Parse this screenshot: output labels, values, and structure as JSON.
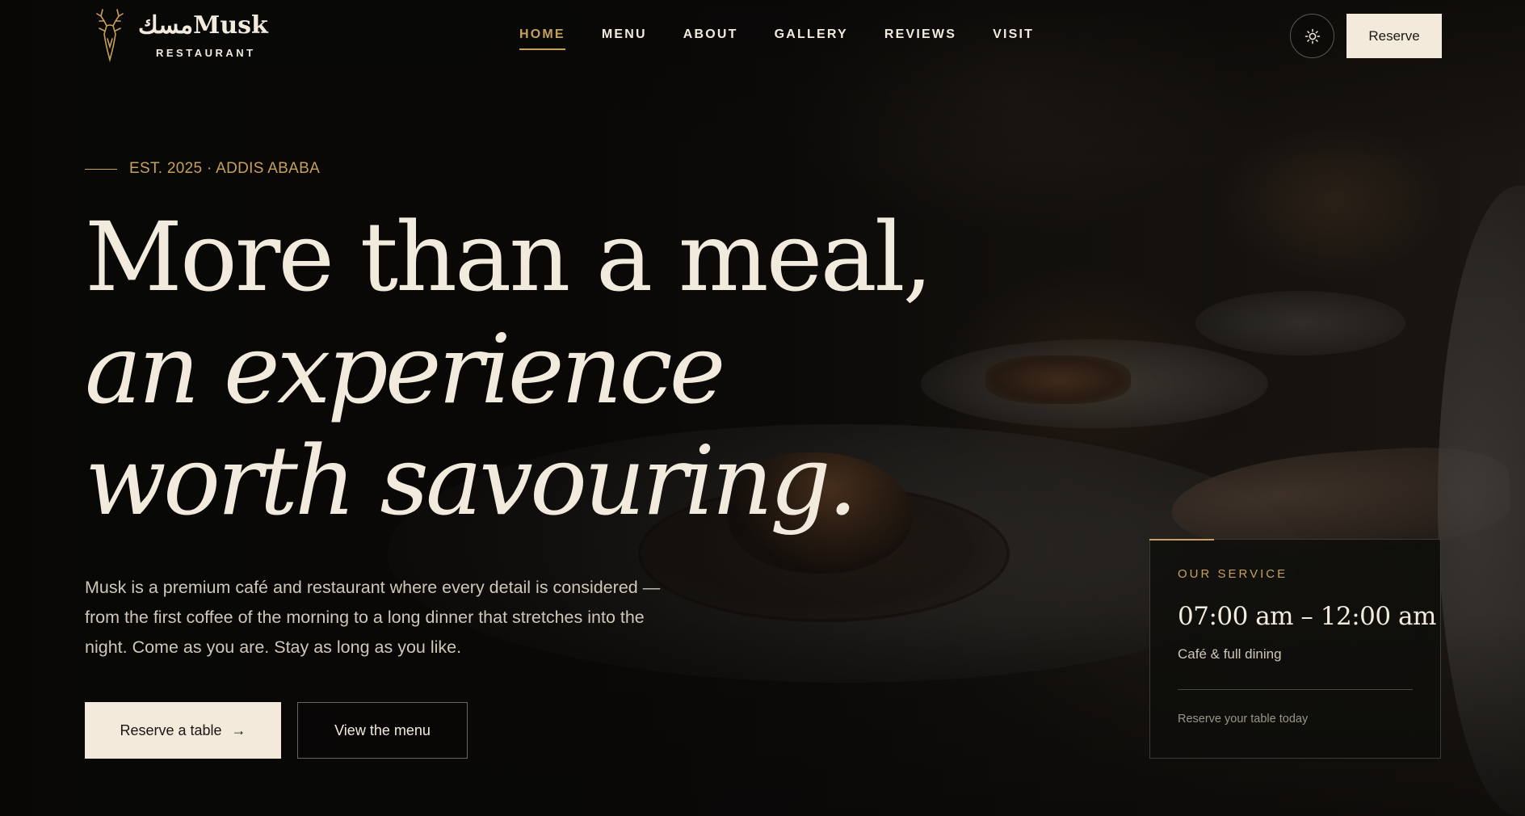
{
  "brand": {
    "wordmark": "مسكMusk",
    "subtitle": "RESTAURANT",
    "logo_icon": "deer-head-icon"
  },
  "nav": {
    "items": [
      {
        "label": "HOME",
        "active": true
      },
      {
        "label": "MENU",
        "active": false
      },
      {
        "label": "ABOUT",
        "active": false
      },
      {
        "label": "GALLERY",
        "active": false
      },
      {
        "label": "REVIEWS",
        "active": false
      },
      {
        "label": "VISIT",
        "active": false
      }
    ],
    "theme_toggle_icon": "sun-icon",
    "reserve_label": "Reserve"
  },
  "hero": {
    "eyebrow": "EST. 2025 · ADDIS ABABA",
    "headline_line1": "More than a meal,",
    "headline_line2": "an experience",
    "headline_line3": "worth savouring.",
    "lede": "Musk is a premium café and restaurant where every detail is considered — from the first coffee of the morning to a long dinner that stretches into the night. Come as you are. Stay as long as you like.",
    "cta_primary": "Reserve a table",
    "cta_primary_icon": "→",
    "cta_secondary": "View the menu"
  },
  "service": {
    "eyebrow": "OUR SERVICE",
    "hours": "07:00 am – 12:00 am",
    "description": "Café & full dining",
    "note": "Reserve your table today"
  },
  "colors": {
    "accent_gold": "#c6a15b",
    "cream": "#f3eadb",
    "background": "#0d0c0a"
  }
}
